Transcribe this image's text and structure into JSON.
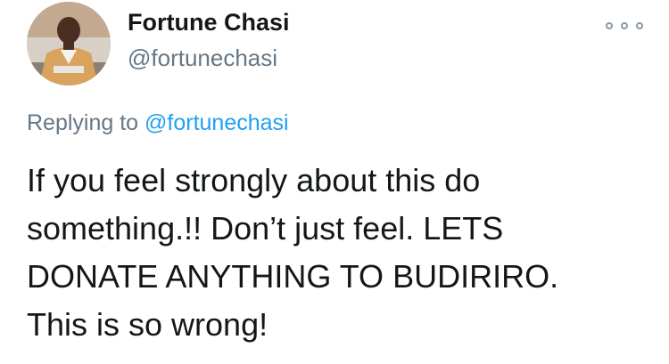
{
  "author": {
    "display_name": "Fortune Chasi",
    "handle": "@fortunechasi",
    "avatar_alt": "profile-photo"
  },
  "menu": {
    "icon": "more-options-icon"
  },
  "reply": {
    "prefix": "Replying to",
    "mention": "@fortunechasi"
  },
  "tweet": {
    "lines": [
      "If you feel strongly about this do",
      "something.!! Don’t just feel. LETS",
      "DONATE ANYTHING TO BUDIRIRO.",
      "This is so wrong!"
    ]
  },
  "colors": {
    "text": "#14171a",
    "secondary": "#657786",
    "link": "#1da1f2",
    "icon": "#8899a6"
  }
}
